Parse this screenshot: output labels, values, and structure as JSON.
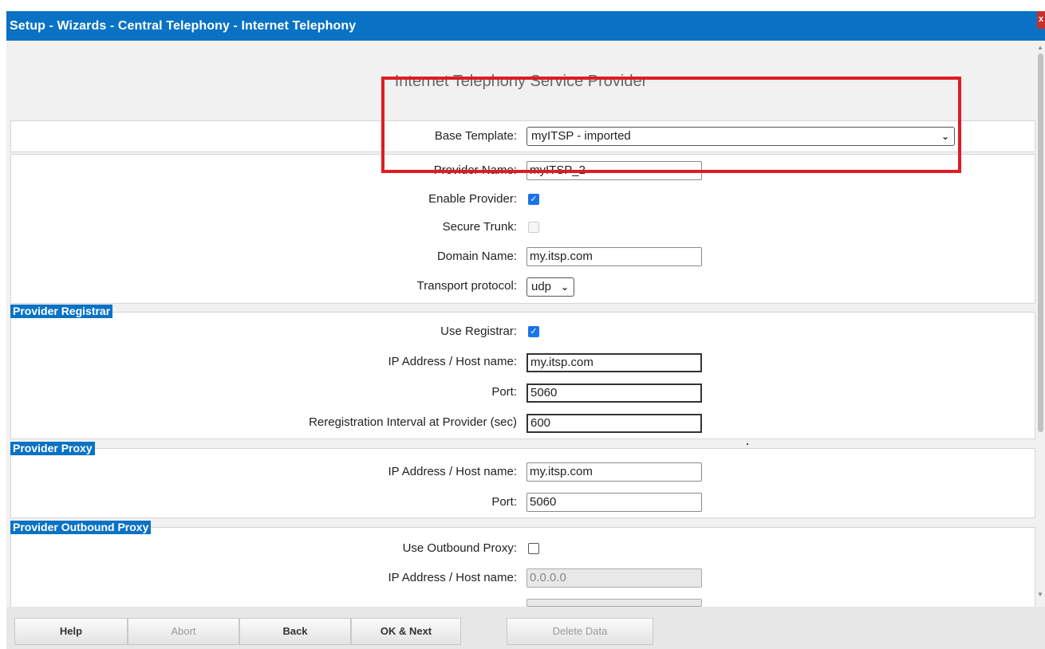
{
  "window": {
    "title": "Setup - Wizards - Central Telephony - Internet Telephony",
    "close_glyph": "x"
  },
  "page": {
    "heading": "Internet Telephony Service Provider"
  },
  "base": {
    "base_template_label": "Base Template:",
    "base_template_value": "myITSP - imported",
    "provider_name_label": "Provider Name:",
    "provider_name_value": "myITSP_2",
    "enable_provider_label": "Enable Provider:",
    "enable_provider_checked": true,
    "secure_trunk_label": "Secure Trunk:",
    "secure_trunk_checked": false,
    "domain_name_label": "Domain Name:",
    "domain_name_value": "my.itsp.com",
    "transport_protocol_label": "Transport protocol:",
    "transport_protocol_value": "udp"
  },
  "registrar": {
    "header": "Provider Registrar",
    "use_registrar_label": "Use Registrar:",
    "use_registrar_checked": true,
    "ip_label": "IP Address / Host name:",
    "ip_value": "my.itsp.com",
    "port_label": "Port:",
    "port_value": "5060",
    "rereg_label": "Reregistration Interval at Provider (sec)",
    "rereg_value": "600"
  },
  "proxy": {
    "header": "Provider Proxy",
    "ip_label": "IP Address / Host name:",
    "ip_value": "my.itsp.com",
    "port_label": "Port:",
    "port_value": "5060"
  },
  "outbound_proxy": {
    "header": "Provider Outbound Proxy",
    "use_label": "Use Outbound Proxy:",
    "use_checked": false,
    "ip_label": "IP Address / Host name:",
    "ip_value": "0.0.0.0"
  },
  "footer": {
    "help": "Help",
    "abort": "Abort",
    "back": "Back",
    "ok_next": "OK & Next",
    "delete_data": "Delete Data"
  },
  "colors": {
    "titlebar": "#0a72c4",
    "highlight": "#e01b24",
    "checkbox_on": "#1a73e8"
  }
}
